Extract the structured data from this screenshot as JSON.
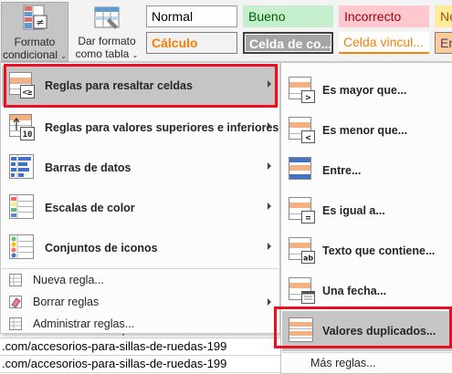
{
  "ribbon": {
    "formato_condicional": [
      "Formato",
      "condicional"
    ],
    "dar_formato": [
      "Dar formato",
      "como tabla"
    ],
    "styles": {
      "normal": "Normal",
      "bueno": "Bueno",
      "incorrecto": "Incorrecto",
      "neutral": "Ne",
      "calculo": "Cálculo",
      "celda_comprobacion": "Celda de co...",
      "celda_vinculada": "Celda vincul...",
      "entrada": "En"
    }
  },
  "main_menu": {
    "items": [
      {
        "label": "Reglas para resaltar celdas",
        "key": "R"
      },
      {
        "label": "Reglas para valores superiores e inferiores",
        "key": "R"
      },
      {
        "label": "Barras de datos",
        "key": "B"
      },
      {
        "label": "Escalas de color",
        "key": "E"
      },
      {
        "label": "Conjuntos de iconos",
        "key": "C"
      }
    ],
    "small_items": [
      {
        "label": "Nueva regla..."
      },
      {
        "label": "Borrar reglas"
      },
      {
        "label": "Administrar reglas..."
      }
    ]
  },
  "submenu": {
    "items": [
      {
        "label": "Es mayor que..."
      },
      {
        "label": "Es menor que..."
      },
      {
        "label": "Entre..."
      },
      {
        "label": "Es igual a..."
      },
      {
        "label": "Texto que contiene..."
      },
      {
        "label": "Una fecha..."
      },
      {
        "label": "Valores duplicados..."
      }
    ],
    "more": "Más reglas..."
  },
  "sheet_rows": [
    ".com/otros-accesorios-para-sillas-de-ruedas-411",
    ".com/accesorios-para-sillas-de-ruedas-199",
    ".com/accesorios-para-sillas-de-ruedas-199"
  ],
  "colors": {
    "highlight": "#c5c5c5",
    "red_frame": "#e81123",
    "icon_blue": "#4472c4",
    "icon_orange": "#f4b183"
  }
}
